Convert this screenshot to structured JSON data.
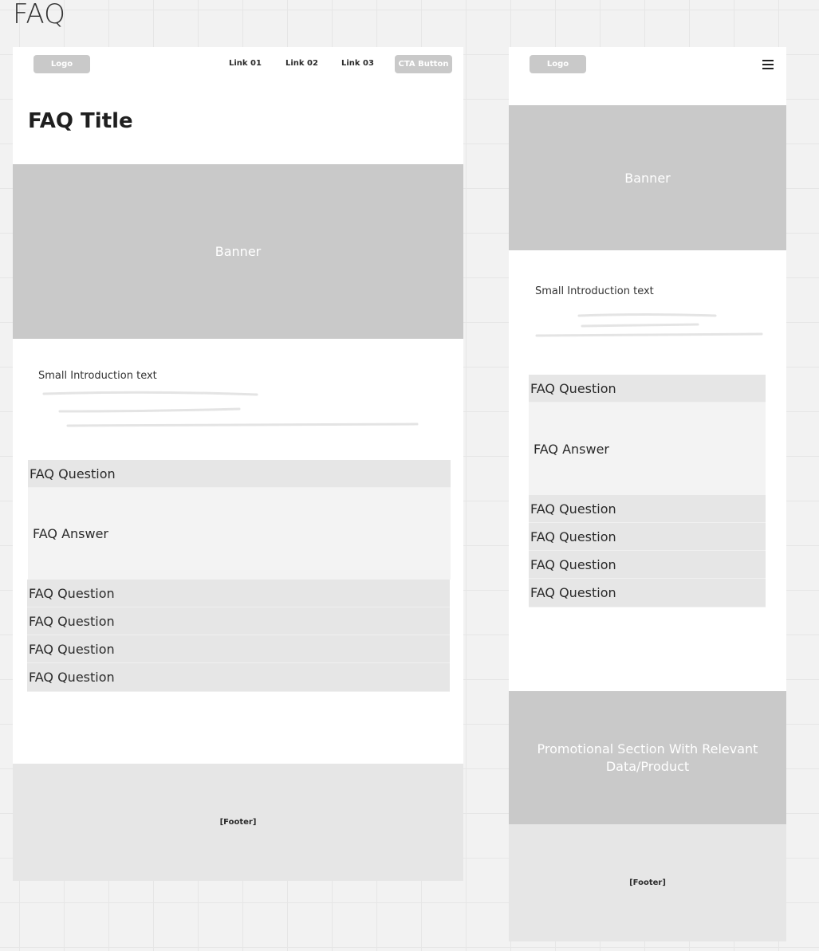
{
  "board": {
    "title": "FAQ"
  },
  "desktop": {
    "header": {
      "logo": "Logo",
      "links": [
        "Link 01",
        "Link 02",
        "Link 03"
      ],
      "cta": "CTA Button"
    },
    "page_title": "FAQ Title",
    "banner": "Banner",
    "intro": "Small Introduction text",
    "faq": {
      "first_question": "FAQ Question",
      "answer": "FAQ Answer",
      "questions": [
        "FAQ Question",
        "FAQ Question",
        "FAQ Question",
        "FAQ Question"
      ]
    },
    "footer": "[Footer]"
  },
  "mobile": {
    "header": {
      "logo": "Logo",
      "menu_icon": "hamburger-icon"
    },
    "banner": "Banner",
    "intro": "Small Introduction text",
    "faq": {
      "first_question": "FAQ Question",
      "answer": "FAQ Answer",
      "questions": [
        "FAQ Question",
        "FAQ Question",
        "FAQ Question",
        "FAQ Question"
      ]
    },
    "promo": "Promotional Section With Relevant Data/Product",
    "footer": "[Footer]"
  }
}
